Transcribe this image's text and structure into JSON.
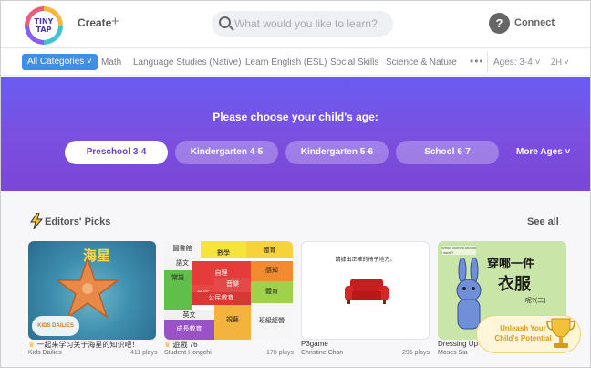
{
  "header": {
    "logo_text": "TINY TAP",
    "create_label": "Create",
    "create_plus": "+",
    "search_placeholder": "What would you like to learn?",
    "connect_icon": "?",
    "connect_label": "Connect"
  },
  "categories": {
    "all_label": "All Categories ˅",
    "items": [
      "Math",
      "Language Studies (Native)",
      "Learn English (ESL)",
      "Social Skills",
      "Science & Nature"
    ],
    "more": "•••",
    "age_select": "Ages: 3-4 ˅",
    "lang_select": "ZH ˅"
  },
  "banner": {
    "title": "Please choose your child's age:",
    "ages": [
      "Preschool 3-4",
      "Kindergarten 4-5",
      "Kindergarten 5-6",
      "School 6-7"
    ],
    "active_index": 0,
    "more_label": "More Ages ˅"
  },
  "picks": {
    "title": "Editors' Picks",
    "see_all": "See all",
    "cards": [
      {
        "title": "一起来学习关于海星的知识吧！",
        "author": "Kids Dailies",
        "plays": "411 plays",
        "cover_text": "海星",
        "brand": "KIDS DAILIES"
      },
      {
        "title": "遊戲 76",
        "author": "Student Hongchi",
        "plays": "178 plays"
      },
      {
        "title": "P3game",
        "author": "Christine Chan",
        "plays": "295 plays",
        "cover_text": "請據出正確的椅子地方。"
      },
      {
        "title": "Dressing Up",
        "author": "Moses Sia",
        "plays": "",
        "cover_line1": "穿哪一件",
        "cover_line2": "衣服",
        "cover_line3": "呢?(二)",
        "cover_tiny": "Which clothes should I wear?"
      }
    ],
    "grid_cells": [
      "圖書館",
      "數學",
      "體育",
      "語文",
      "常識",
      "自理",
      "感知",
      "音樂",
      "體育",
      "美術",
      "公民教育",
      "英文",
      "成長教育",
      "視藝",
      "班級經營"
    ]
  },
  "promo": {
    "line1": "Unleash Your",
    "line2": "Child's Potential"
  },
  "colors": {
    "accent": "#3f8fe6",
    "banner_top": "#6a5cf2",
    "banner_bottom": "#7a46d6",
    "active_age_text": "#6a3fd0"
  }
}
